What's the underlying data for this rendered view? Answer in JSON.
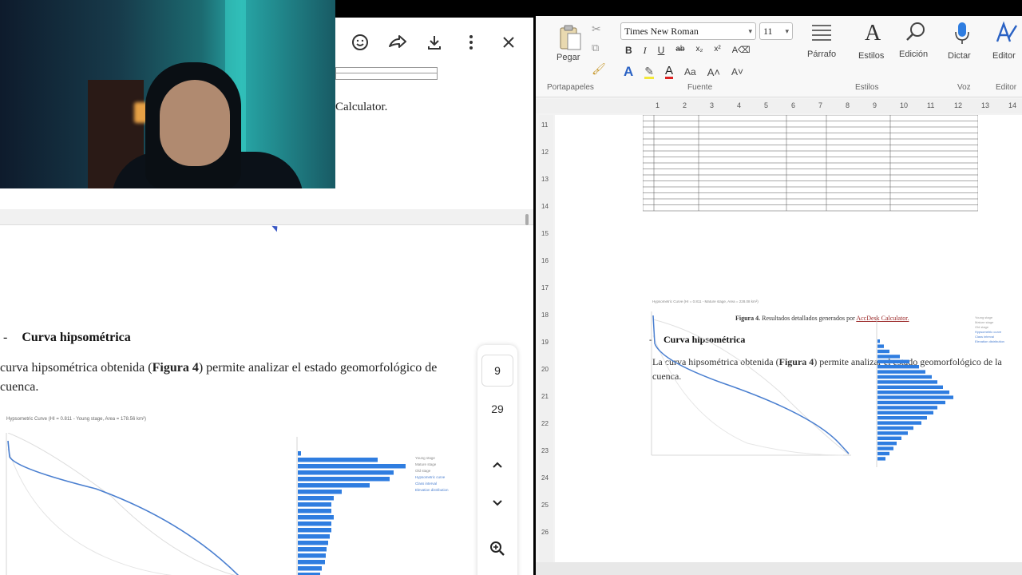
{
  "left_viewer": {
    "toolbar": {
      "emoji_icon": "smiley-icon",
      "share_icon": "share-icon",
      "download_icon": "download-icon",
      "more_icon": "more-vertical-icon",
      "close_icon": "close-icon"
    },
    "calc_text": "Calculator.",
    "heading_bullet": "-",
    "heading": "Curva hipsométrica",
    "paragraph_prefix": "curva hipsométrica obtenida (",
    "paragraph_bold": "Figura 4",
    "paragraph_suffix": ") permite analizar el estado geomorfológico de",
    "paragraph_line2": "cuenca.",
    "chart_title": "Hypsometric Curve (HI = 0.811 - Young stage, Area = 178.56 km²)",
    "legend": [
      "Young stage",
      "Mature stage",
      "Old stage",
      "Hypsometric curve",
      "Class interval",
      "Elevation distribution"
    ],
    "page_nav": {
      "current": "9",
      "total": "29"
    }
  },
  "word": {
    "clipboard": {
      "paste": "Pegar",
      "group": "Portapapeles"
    },
    "font": {
      "name": "Times New Roman",
      "size": "11",
      "group": "Fuente"
    },
    "paragraph": {
      "label": "Párrafo"
    },
    "styles": {
      "label": "Estilos",
      "group": "Estilos"
    },
    "editing": {
      "label": "Edición"
    },
    "voice": {
      "label": "Dictar",
      "group": "Voz"
    },
    "editor": {
      "label": "Editor",
      "group": "Editor"
    },
    "ruler_numbers": [
      "1",
      "2",
      "3",
      "4",
      "5",
      "6",
      "7",
      "8",
      "9",
      "10",
      "11",
      "12",
      "13",
      "14"
    ],
    "vruler_numbers": [
      "11",
      "12",
      "13",
      "14",
      "15",
      "16",
      "17",
      "18",
      "19",
      "20",
      "21",
      "22",
      "23",
      "24",
      "25",
      "26"
    ],
    "figure_caption_bold": "Figura 4.",
    "figure_caption_text": "Resultados detallados generados por",
    "figure_caption_link": "AccDesk Calculator.",
    "heading_bullet": "-",
    "heading": "Curva hipsométrica",
    "paragraph_prefix": "La curva hipsométrica obtenida (",
    "paragraph_bold": "Figura 4",
    "paragraph_suffix": ") permite analizar el estado geomorfológico de la",
    "paragraph_line2": "cuenca.",
    "chart_title": "Hypsometric Curve (HI = 0.811 - Mature stage, Area = 228.08 km²)",
    "legend": [
      "Young stage",
      "Mature stage",
      "Old stage",
      "Hypsometric curve",
      "Class interval",
      "Elevation distribution"
    ]
  },
  "colors": {
    "chart_blue": "#4a7fd0",
    "hist_blue": "#2f7de0",
    "link_red": "#9c2a2a"
  }
}
